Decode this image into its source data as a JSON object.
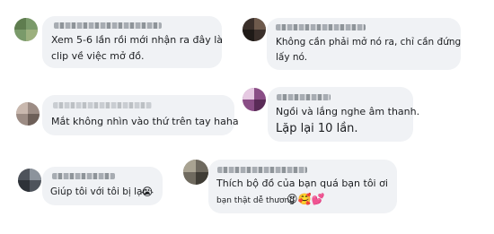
{
  "comments": [
    {
      "id": "c1",
      "lines": [
        "Xem 5-6 lần rồi mới nhận ra đây là",
        "clip về việc mở đồ."
      ]
    },
    {
      "id": "c2",
      "lines": [
        "Không cần phải mở nó ra, chỉ cần đứng",
        "lấy nó."
      ]
    },
    {
      "id": "c3",
      "lines": [
        "Mắt không nhìn vào thứ trên tay haha"
      ]
    },
    {
      "id": "c4",
      "lines": [
        "Ngồi và lắng nghe âm thanh.",
        "Lặp lại 10 lần."
      ]
    },
    {
      "id": "c5",
      "lines": [
        "Giúp tôi với tôi bị lạc"
      ],
      "emoji": "😭"
    },
    {
      "id": "c6",
      "lines": [
        "Thích bộ đồ của bạn quá bạn tôi ơi"
      ],
      "reply": "bạn thật dễ thương",
      "emoji": "😍🥰💕"
    }
  ]
}
